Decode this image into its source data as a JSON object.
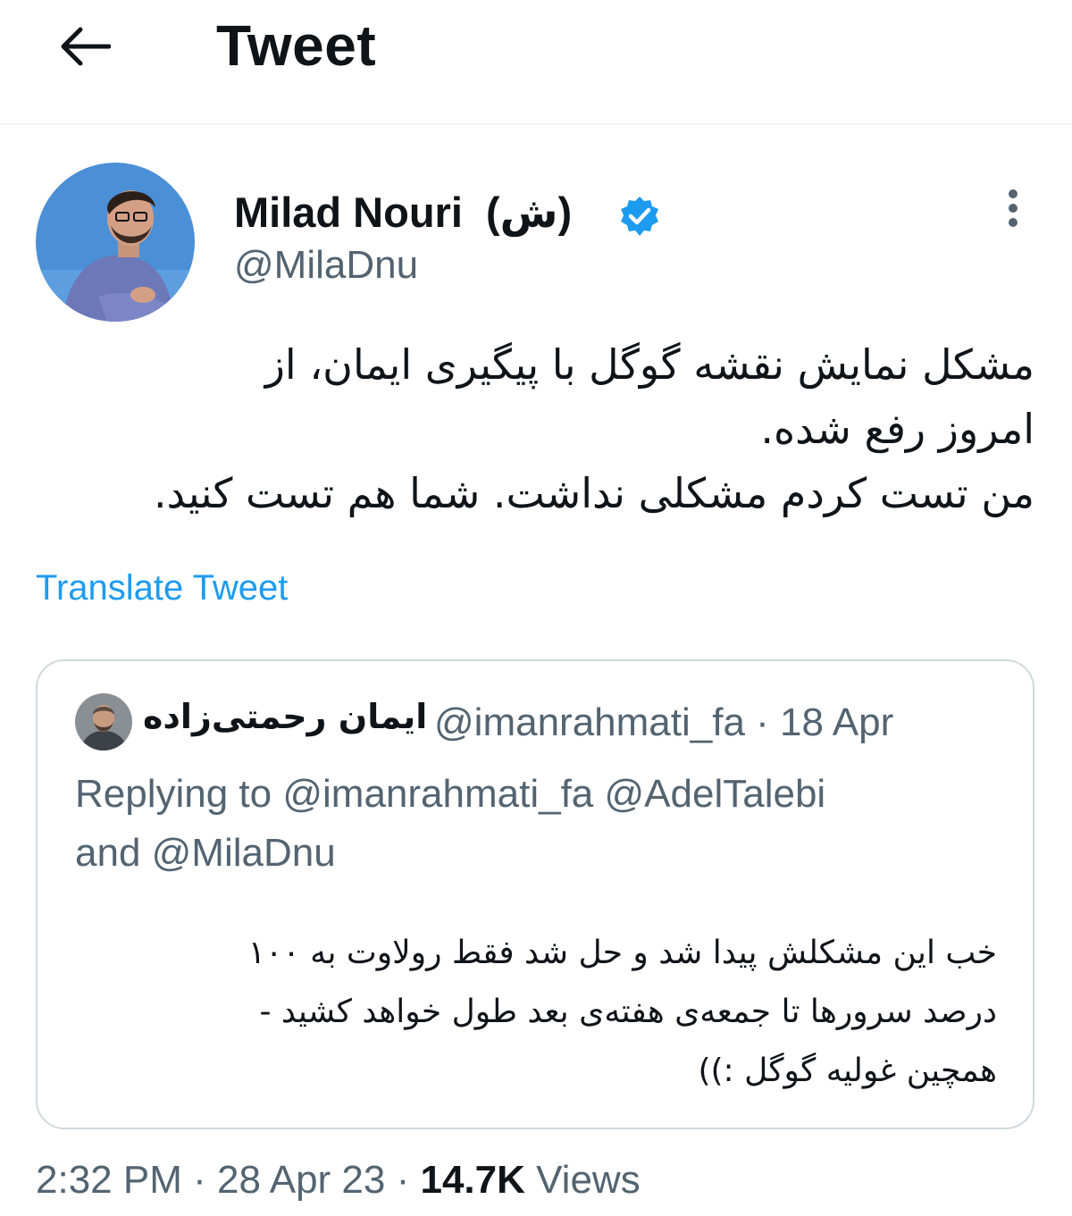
{
  "header": {
    "title": "Tweet"
  },
  "author": {
    "name": "Milad Nouri  (ش)",
    "handle": "@MilaDnu"
  },
  "tweet": {
    "lines": [
      "مشکل نمایش نقشه گوگل با پیگیری ایمان، از",
      "امروز رفع شده.",
      "من تست کردم مشکلی نداشت. شما هم تست کنید."
    ],
    "translate_label": "Translate Tweet",
    "time": "2:32 PM",
    "separator": " · ",
    "date": "28 Apr 23",
    "views_count": "14.7K",
    "views_label": " Views"
  },
  "quote": {
    "author_name": "ایمان رحمتی‌زاده",
    "meta": "@imanrahmati_fa · 18 Apr",
    "replying_line1": "Replying to @imanrahmati_fa @AdelTalebi",
    "replying_line2": "and @MilaDnu",
    "lines": [
      "خب این مشکلش پیدا شد و حل شد فقط رولاوت به ۱۰۰",
      "درصد سرورها تا جمعه‌ی هفته‌ی بعد طول خواهد کشید -",
      "همچین غولیه گوگل :))"
    ]
  },
  "colors": {
    "accent": "#1d9bf0",
    "secondary_text": "#536471",
    "border": "#cfd9de"
  }
}
